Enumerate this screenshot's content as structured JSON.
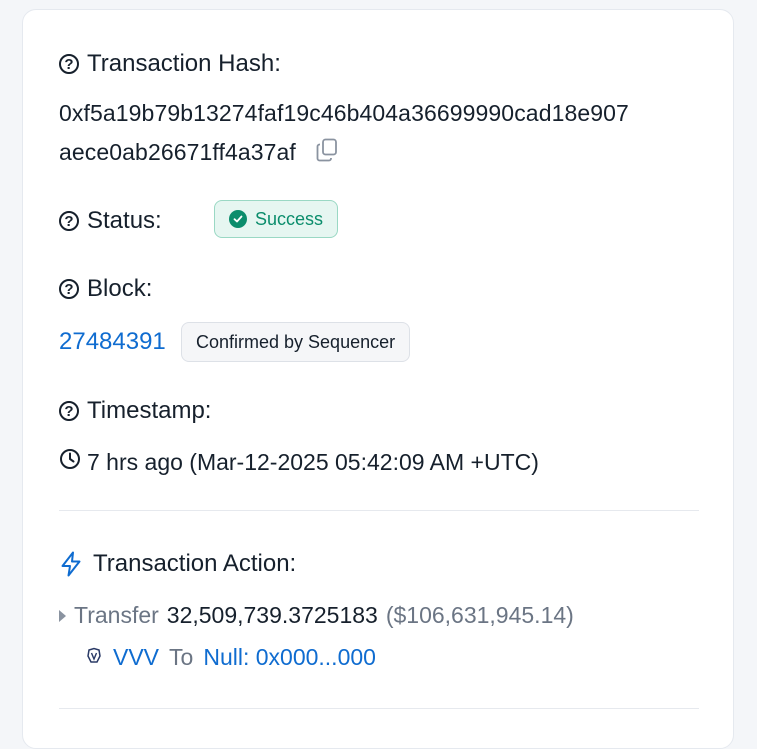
{
  "hash_section": {
    "label": "Transaction Hash:",
    "line1": "0xf5a19b79b13274faf19c46b404a36699990cad18e907",
    "line2": "aece0ab26671ff4a37af"
  },
  "status_section": {
    "label": "Status:",
    "value": "Success"
  },
  "block_section": {
    "label": "Block:",
    "number": "27484391",
    "badge": "Confirmed by Sequencer"
  },
  "timestamp_section": {
    "label": "Timestamp:",
    "value": "7 hrs ago (Mar-12-2025 05:42:09 AM +UTC)"
  },
  "action_section": {
    "label": "Transaction Action:",
    "verb": "Transfer",
    "amount": "32,509,739.3725183",
    "usd": "($106,631,945.14)",
    "token": "VVV",
    "to_word": "To",
    "destination": "Null: 0x000...000"
  },
  "colors": {
    "success_text": "#0b8d6c",
    "success_bg": "#e6f6f1",
    "link": "#0f6cd0",
    "text": "#16202c"
  },
  "icons": [
    "help-circle-icon",
    "copy-icon",
    "check-circle-icon",
    "clock-icon",
    "lightning-icon",
    "caret-right-icon",
    "token-logo-icon"
  ]
}
